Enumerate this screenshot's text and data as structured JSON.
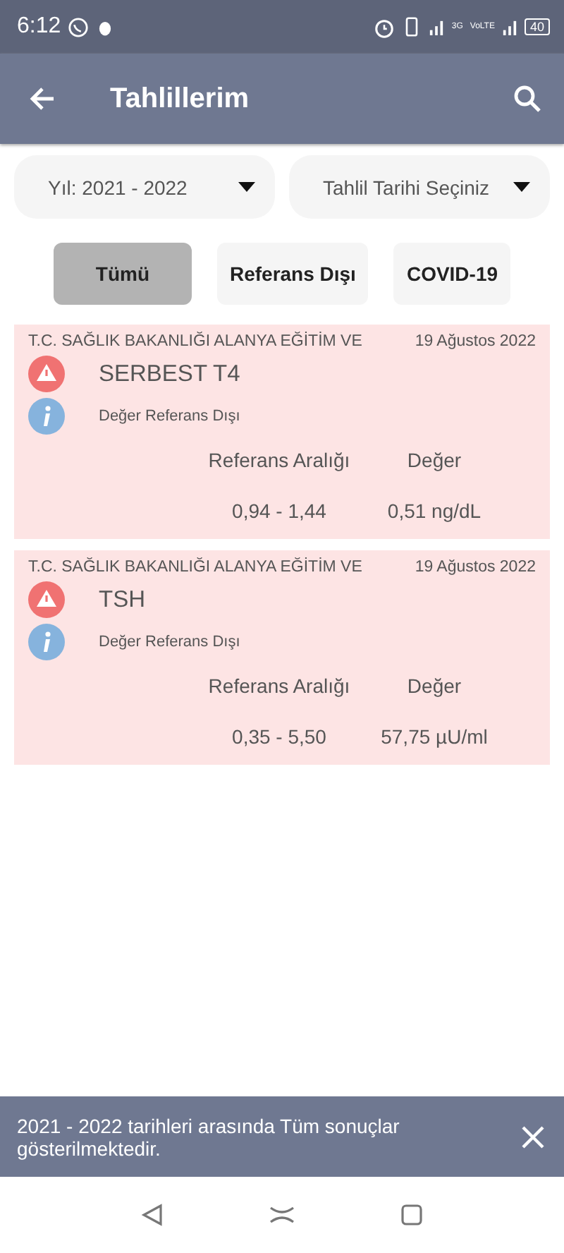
{
  "status_bar": {
    "time": "6:12",
    "network": "3G",
    "volte": "VoLTE",
    "battery": "40"
  },
  "app_bar": {
    "title": "Tahlillerim"
  },
  "filters": [
    {
      "label": "Yıl: 2021 - 2022"
    },
    {
      "label": "Tahlil Tarihi Seçiniz"
    }
  ],
  "tabs": [
    {
      "label": "Tümü",
      "selected": true
    },
    {
      "label": "Referans Dışı",
      "selected": false
    },
    {
      "label": "COVID-19",
      "selected": false
    }
  ],
  "results": [
    {
      "hospital": "T.C. SAĞLIK BAKANLIĞI ALANYA EĞİTİM VE",
      "date": "19 Ağustos 2022",
      "test": "SERBEST T4",
      "status": "Değer Referans Dışı",
      "range_header": "Referans Aralığı",
      "value_header": "Değer",
      "range": "0,94 - 1,44",
      "value": "0,51 ng/dL",
      "out_of_range": true
    },
    {
      "hospital": "T.C. SAĞLIK BAKANLIĞI ALANYA EĞİTİM VE",
      "date": "19 Ağustos 2022",
      "test": "TSH",
      "status": "Değer Referans Dışı",
      "range_header": "Referans Aralığı",
      "value_header": "Değer",
      "range": "0,35 - 5,50",
      "value": "57,75 µU/ml",
      "out_of_range": true
    }
  ],
  "snackbar": {
    "message": "2021 - 2022 tarihleri arasında Tüm sonuçlar gösterilmektedir."
  }
}
